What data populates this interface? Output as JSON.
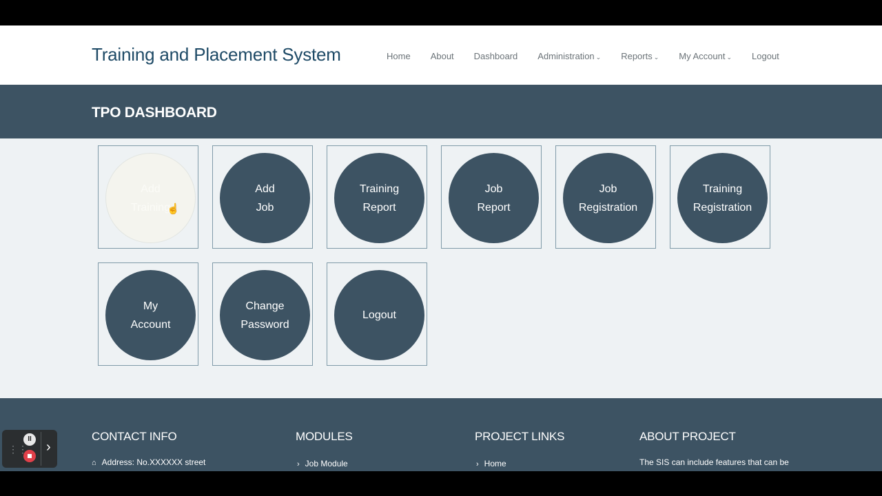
{
  "header": {
    "brand": "Training and Placement System",
    "nav": [
      "Home",
      "About",
      "Dashboard",
      "Administration",
      "Reports",
      "My Account",
      "Logout"
    ]
  },
  "banner": {
    "title": "TPO DASHBOARD"
  },
  "tiles": [
    [
      "Add",
      "Training"
    ],
    [
      "Add",
      "Job"
    ],
    [
      "Training",
      "Report"
    ],
    [
      "Job",
      "Report"
    ],
    [
      "Job",
      "Registration"
    ],
    [
      "Training",
      "Registration"
    ],
    [
      "My",
      "Account"
    ],
    [
      "Change",
      "Password"
    ],
    [
      "Logout"
    ]
  ],
  "footer": {
    "contact_heading": "CONTACT INFO",
    "contact_address": "Address: No.XXXXXX street",
    "modules_heading": "MODULES",
    "modules_first": "Job Module",
    "links_heading": "PROJECT LINKS",
    "links_first": "Home",
    "about_heading": "ABOUT PROJECT",
    "about_text": "The SIS can include features that can be"
  },
  "icons": {
    "dropdown": "chevron-down-icon",
    "cursor": "hand-pointer-icon",
    "home": "home-icon",
    "link": "chevron-right-icon"
  },
  "colors": {
    "primary": "#3d5363",
    "brand_text": "#1e4a66",
    "content_bg": "#eef2f4"
  }
}
